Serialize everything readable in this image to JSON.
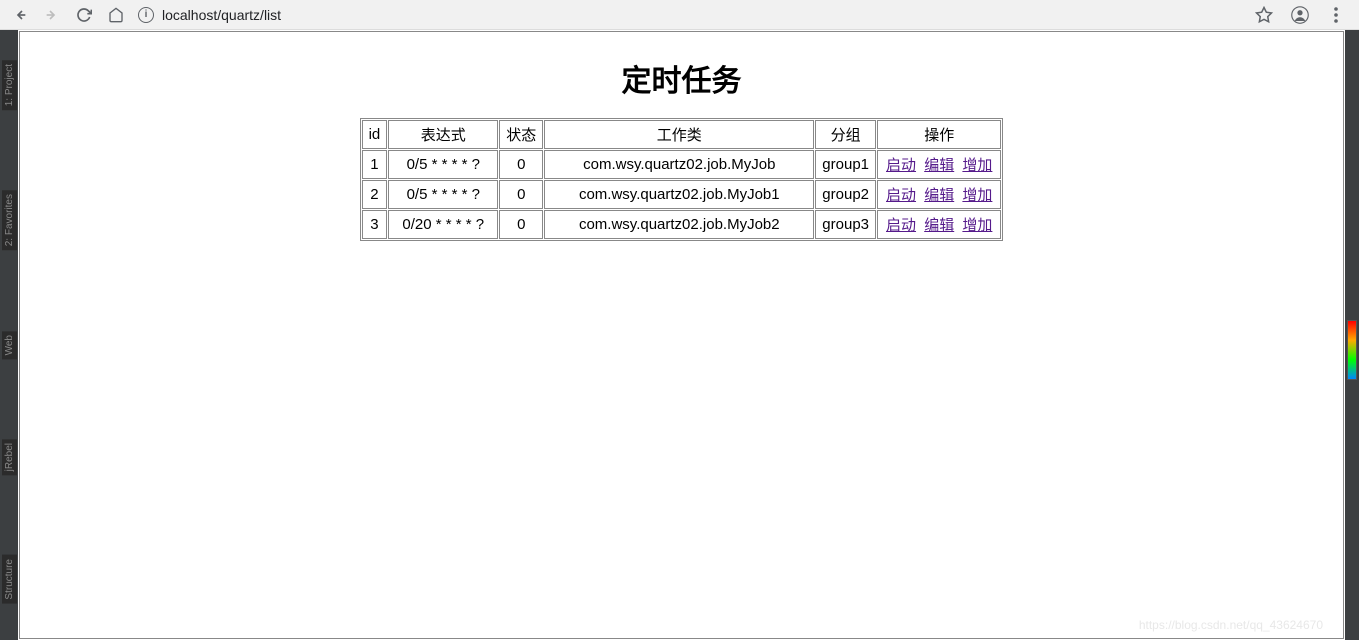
{
  "browser": {
    "url": "localhost/quartz/list"
  },
  "page": {
    "title": "定时任务"
  },
  "table": {
    "headers": {
      "id": "id",
      "expr": "表达式",
      "status": "状态",
      "class": "工作类",
      "group": "分组",
      "action": "操作"
    },
    "rows": [
      {
        "id": "1",
        "expr": "0/5 * * * * ?",
        "status": "0",
        "class": "com.wsy.quartz02.job.MyJob",
        "group": "group1"
      },
      {
        "id": "2",
        "expr": "0/5 * * * * ?",
        "status": "0",
        "class": "com.wsy.quartz02.job.MyJob1",
        "group": "group2"
      },
      {
        "id": "3",
        "expr": "0/20 * * * * ?",
        "status": "0",
        "class": "com.wsy.quartz02.job.MyJob2",
        "group": "group3"
      }
    ],
    "actions": {
      "start": "启动",
      "edit": "编辑",
      "add": "增加"
    }
  },
  "ide": {
    "tab1": "1: Project",
    "tab2": "2: Favorites",
    "tab3": "Structure",
    "tab4": "Web",
    "tab5": "jRebel"
  },
  "watermark": "https://blog.csdn.net/qq_43624670"
}
